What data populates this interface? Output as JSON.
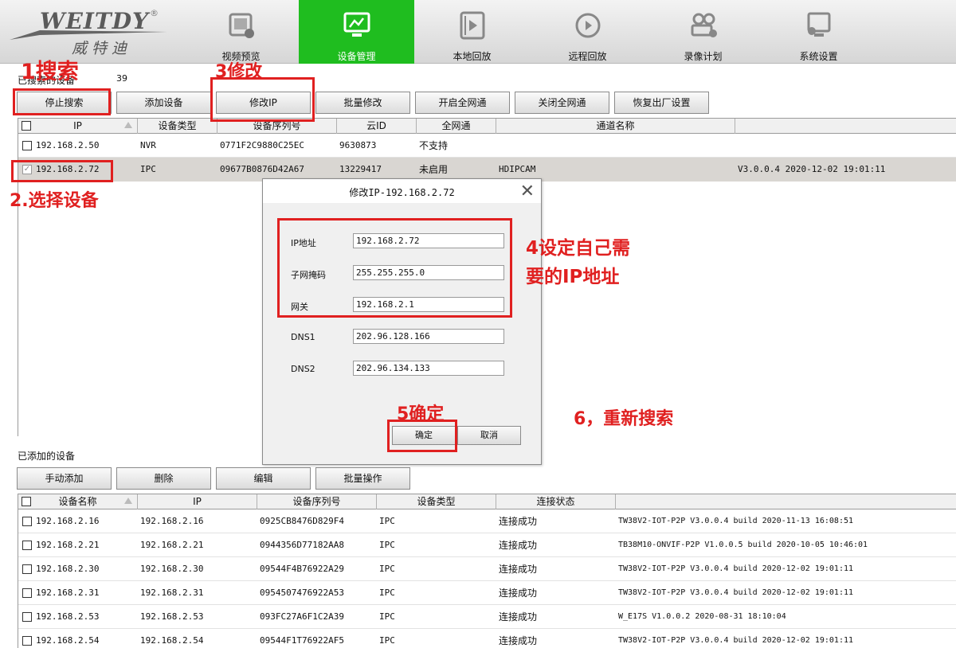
{
  "brand": {
    "name": "WEITDY",
    "registered": "®",
    "chinese": "威特迪"
  },
  "nav": {
    "tabs": [
      {
        "label": "视频预览",
        "icon": "video-preview-icon"
      },
      {
        "label": "设备管理",
        "icon": "device-management-icon",
        "active": true
      },
      {
        "label": "本地回放",
        "icon": "local-playback-icon"
      },
      {
        "label": "远程回放",
        "icon": "remote-playback-icon"
      },
      {
        "label": "录像计划",
        "icon": "recording-plan-icon"
      },
      {
        "label": "系统设置",
        "icon": "system-settings-icon"
      }
    ],
    "active_color": "#1fbd1f"
  },
  "searched": {
    "label": "已搜索的设备",
    "count": "39",
    "buttons": {
      "stop_search": "停止搜索",
      "add_device": "添加设备",
      "modify_ip": "修改IP",
      "batch_modify": "批量修改",
      "enable_all": "开启全网通",
      "disable_all": "关闭全网通",
      "factory_reset": "恢复出厂设置"
    },
    "columns": [
      "IP",
      "设备类型",
      "设备序列号",
      "云ID",
      "全网通",
      "通道名称",
      ""
    ],
    "rows": [
      {
        "ip": "192.168.2.50",
        "type": "NVR",
        "serial": "0771F2C9880C25EC",
        "cloud_id": "9630873",
        "all_net": "不支持",
        "channel": "",
        "extra": "",
        "checked": false
      },
      {
        "ip": "192.168.2.72",
        "type": "IPC",
        "serial": "09677B0876D42A67",
        "cloud_id": "13229417",
        "all_net": "未启用",
        "channel": "HDIPCAM",
        "extra": "V3.0.0.4 2020-12-02 19:01:11",
        "checked": true
      }
    ]
  },
  "added": {
    "label": "已添加的设备",
    "buttons": {
      "manual_add": "手动添加",
      "delete": "删除",
      "edit": "编辑",
      "batch_ops": "批量操作"
    },
    "columns": [
      "设备名称",
      "IP",
      "设备序列号",
      "设备类型",
      "连接状态",
      ""
    ],
    "rows": [
      {
        "name": "192.168.2.16",
        "ip": "192.168.2.16",
        "serial": "0925CB8476D829F4",
        "type": "IPC",
        "status": "连接成功",
        "info": "TW38V2-IOT-P2P V3.0.0.4 build 2020-11-13 16:08:51"
      },
      {
        "name": "192.168.2.21",
        "ip": "192.168.2.21",
        "serial": "0944356D77182AA8",
        "type": "IPC",
        "status": "连接成功",
        "info": "TB38M10-ONVIF-P2P V1.0.0.5 build 2020-10-05 10:46:01"
      },
      {
        "name": "192.168.2.30",
        "ip": "192.168.2.30",
        "serial": "09544F4B76922A29",
        "type": "IPC",
        "status": "连接成功",
        "info": "TW38V2-IOT-P2P V3.0.0.4 build 2020-12-02 19:01:11"
      },
      {
        "name": "192.168.2.31",
        "ip": "192.168.2.31",
        "serial": "0954507476922A53",
        "type": "IPC",
        "status": "连接成功",
        "info": "TW38V2-IOT-P2P V3.0.0.4 build 2020-12-02 19:01:11"
      },
      {
        "name": "192.168.2.53",
        "ip": "192.168.2.53",
        "serial": "093FC27A6F1C2A39",
        "type": "IPC",
        "status": "连接成功",
        "info": "W_E17S V1.0.0.2 2020-08-31 18:10:04"
      },
      {
        "name": "192.168.2.54",
        "ip": "192.168.2.54",
        "serial": "09544F1T76922AF5",
        "type": "IPC",
        "status": "连接成功",
        "info": "TW38V2-IOT-P2P V3.0.0.4 build 2020-12-02 19:01:11"
      }
    ]
  },
  "dialog": {
    "title": "修改IP-192.168.2.72",
    "fields": {
      "ip_label": "IP地址",
      "ip": "192.168.2.72",
      "mask_label": "子网掩码",
      "mask": "255.255.255.0",
      "gateway_label": "网关",
      "gateway": "192.168.2.1",
      "dns1_label": "DNS1",
      "dns1": "202.96.128.166",
      "dns2_label": "DNS2",
      "dns2": "202.96.134.133"
    },
    "ok": "确定",
    "cancel": "取消"
  },
  "annotations": {
    "step1": "1搜索",
    "step2": "2.选择设备",
    "step3": "3修改",
    "step4_line1": "4设定自己需",
    "step4_line2": "要的IP地址",
    "step5": "5确定",
    "step6": "6，重新搜索",
    "color": "#e02020"
  }
}
